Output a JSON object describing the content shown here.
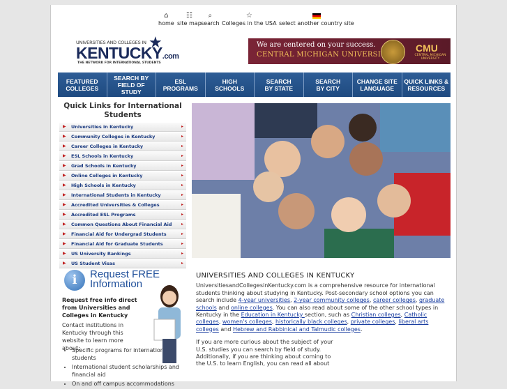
{
  "top_nav": {
    "home": "home",
    "site_map": "site map",
    "search": "search",
    "colleges_usa": "Colleges in the USA",
    "country": "select another country site"
  },
  "logo": {
    "small": "UNIVERSITIES AND COLLEGES IN",
    "big": "KENTUCKY",
    "com": ".com",
    "tagline": "THE NETWORK FOR INTERNATIONAL STUDENTS"
  },
  "ad": {
    "line1": "We are centered on your success.",
    "line2": "CENTRAL MICHIGAN UNIVERSITY",
    "logo": "CMU",
    "logo_sub": "CENTRAL MICHIGAN UNIVERSITY"
  },
  "main_nav": [
    {
      "l1": "FEATURED",
      "l2": "COLLEGES"
    },
    {
      "l1": "SEARCH BY",
      "l2": "FIELD OF STUDY"
    },
    {
      "l1": "ESL",
      "l2": "PROGRAMS"
    },
    {
      "l1": "HIGH",
      "l2": "SCHOOLS"
    },
    {
      "l1": "SEARCH",
      "l2": "BY STATE"
    },
    {
      "l1": "SEARCH",
      "l2": "BY CITY"
    },
    {
      "l1": "CHANGE SITE",
      "l2": "LANGUAGE"
    },
    {
      "l1": "QUICK LINKS &",
      "l2": "RESOURCES"
    }
  ],
  "quick_links": {
    "title_l1": "Quick Links for International",
    "title_l2": "Students",
    "items": [
      "Universities in Kentucky",
      "Community Colleges in Kentucky",
      "Career Colleges in Kentucky",
      "ESL Schools in Kentucky",
      "Grad Schools in Kentucky",
      "Online Colleges in Kentucky",
      "High Schools in Kentucky",
      "International Students in Kentucky",
      "Accredited Universities & Colleges",
      "Accredited ESL Programs",
      "Common Questions About Financial Aid",
      "Financial Aid for Undergrad Students",
      "Financial Aid for Graduate Students",
      "US University Rankings",
      "US Student Visas"
    ]
  },
  "request": {
    "title_l1": "Request FREE",
    "title_l2": "Information",
    "bold": "Request free info direct from Universities and Colleges in Kentucky",
    "contact": "Contact institutions in Kentucky through this website to learn more about:",
    "bullets": [
      "Specific programs for international students",
      "International student scholarships and financial aid",
      "On and off campus accommodations"
    ]
  },
  "article": {
    "heading": "UNIVERSITIES AND COLLEGES IN KENTUCKY",
    "p1a": "UniversitiesandCollegesinKentucky.com is a comprehensive resource for international students thinking about studying in Kentucky. Post-secondary school options you can search include ",
    "link_4yr": "4-year universities",
    "link_2yr": "2-year community colleges",
    "link_career": "career colleges",
    "link_grad": "graduate schools",
    "t_and": " and ",
    "link_online": "online colleges",
    "p1b": ". You can also read about some of the  other school types in Kentucky in the ",
    "link_edu": "Education in Kentucky ",
    "p1c": "section, such as ",
    "link_christian": "Christian colleges",
    "link_catholic": "Catholic colleges",
    "link_women": "women's colleges",
    "link_hbc": "historically black colleges",
    "link_private": "private colleges",
    "link_liberal": "liberal arts colleges",
    "t_and2": " and ",
    "link_hebrew": "Hebrew and Rabbinical and Talmudic colleges",
    "p2": "If you are more curious about the subject of your U.S. studies you can search by field of study. Additionally, if you are thinking about coming to the U.S. to learn English, you can read all about"
  }
}
